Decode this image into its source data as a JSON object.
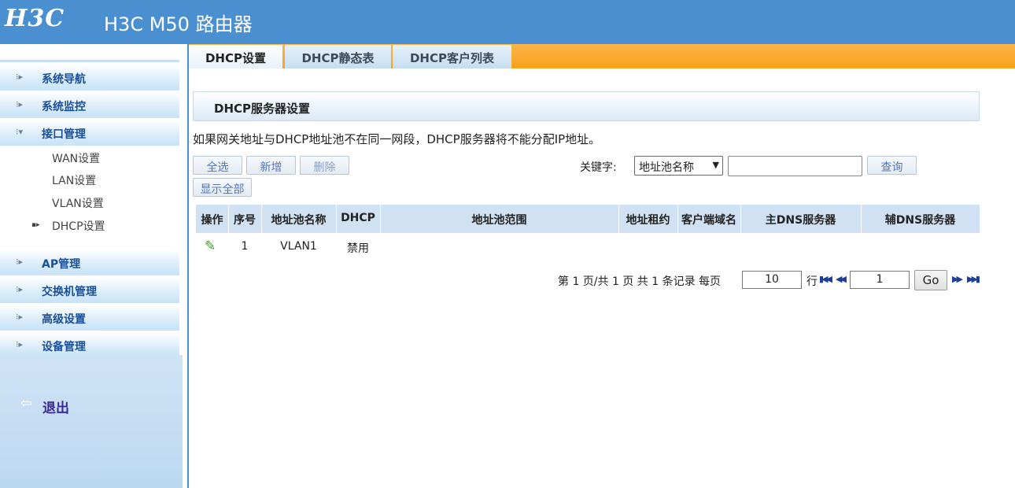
{
  "header": {
    "logo": "H3C",
    "title": "H3C M50 路由器"
  },
  "sidebar": {
    "items": [
      {
        "label": "系统导航",
        "icon": "dots-arrow-icon"
      },
      {
        "label": "系统监控",
        "icon": "dots-arrow-icon"
      },
      {
        "label": "接口管理",
        "icon": "dots-arrow-down-icon",
        "expanded": true
      },
      {
        "label": "AP管理",
        "icon": "dots-arrow-icon"
      },
      {
        "label": "交换机管理",
        "icon": "dots-arrow-icon"
      },
      {
        "label": "高级设置",
        "icon": "dots-arrow-icon"
      },
      {
        "label": "设备管理",
        "icon": "dots-arrow-icon"
      }
    ],
    "subitems": [
      {
        "label": "WAN设置"
      },
      {
        "label": "LAN设置"
      },
      {
        "label": "VLAN设置"
      },
      {
        "label": "DHCP设置",
        "selected": true
      }
    ],
    "logout": {
      "label": "退出",
      "icon": "logout-icon"
    }
  },
  "tabs": [
    {
      "label": "DHCP设置",
      "active": true
    },
    {
      "label": "DHCP静态表",
      "active": false
    },
    {
      "label": "DHCP客户列表",
      "active": false
    }
  ],
  "section": {
    "title": "DHCP服务器设置"
  },
  "notice": "如果网关地址与DHCP地址池不在同一网段，DHCP服务器将不能分配IP地址。",
  "toolbar": {
    "select_all": "全选",
    "add": "新增",
    "delete": "删除",
    "show_all": "显示全部",
    "keyword_label": "关键字:",
    "keyword_select": "地址池名称",
    "keyword_value": "",
    "search": "查询"
  },
  "table": {
    "columns": [
      "操作",
      "序号",
      "地址池名称",
      "DHCP",
      "地址池范围",
      "地址租约",
      "客户端域名",
      "主DNS服务器",
      "辅DNS服务器"
    ],
    "rows": [
      {
        "index": "1",
        "pool_name": "VLAN1",
        "dhcp": "禁用",
        "range": "",
        "lease": "",
        "domain": "",
        "dns1": "",
        "dns2": ""
      }
    ]
  },
  "pagination": {
    "summary": "第 1 页/共 1 页 共 1 条记录 每页",
    "per_page": "10",
    "rows_unit": "行",
    "page": "1",
    "go": "Go"
  },
  "colors": {
    "header": "#4a8fd0",
    "tabbar": "#f7a21b",
    "nav_text": "#1a4f9c"
  }
}
